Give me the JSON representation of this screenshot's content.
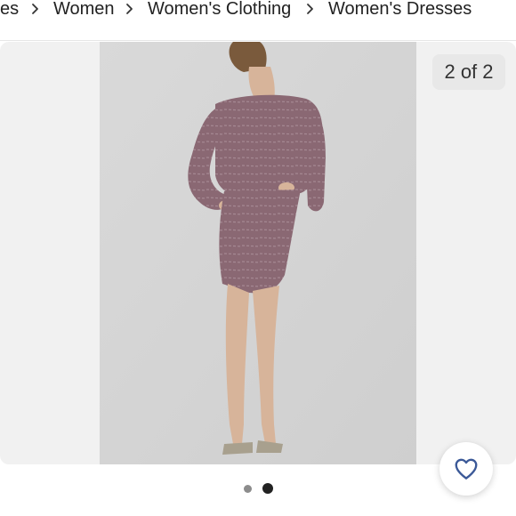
{
  "breadcrumb": {
    "items": [
      "es",
      "Women",
      "Women's Clothing",
      "Women's Dresses"
    ]
  },
  "gallery": {
    "counter": "2 of 2",
    "dot_count": 2,
    "active_dot": 2
  },
  "colors": {
    "gallery_bg": "#f1f1f1",
    "dress": "#8a6873",
    "heart": "#3b5998",
    "dot_active": "#222222",
    "dot_inactive": "#8c8c8c"
  },
  "icons": {
    "separator": "chevron-right-icon",
    "like": "heart-icon"
  }
}
